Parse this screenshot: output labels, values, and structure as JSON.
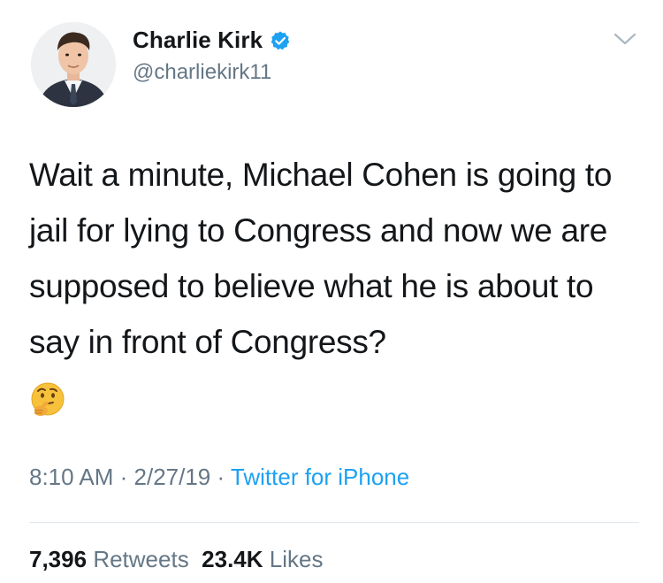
{
  "author": {
    "display_name": "Charlie Kirk",
    "handle": "@charliekirk11",
    "verified": true
  },
  "icons": {
    "verified": "verified-badge-icon",
    "menu": "chevron-down-icon",
    "emoji": "thinking-face-emoji"
  },
  "tweet": {
    "text": "Wait a minute, Michael Cohen is going to jail for lying to Congress and now we are supposed to believe what he is about to say in front of Congress?",
    "emoji": "🤔"
  },
  "meta": {
    "time": "8:10 AM",
    "separator": " · ",
    "date": "2/27/19",
    "source": "Twitter for iPhone"
  },
  "stats": {
    "retweets_count": "7,396",
    "retweets_label": "Retweets",
    "likes_count": "23.4K",
    "likes_label": "Likes"
  },
  "colors": {
    "text": "#14171a",
    "secondary": "#657786",
    "accent": "#1da1f2",
    "divider": "#e1e8ed"
  }
}
